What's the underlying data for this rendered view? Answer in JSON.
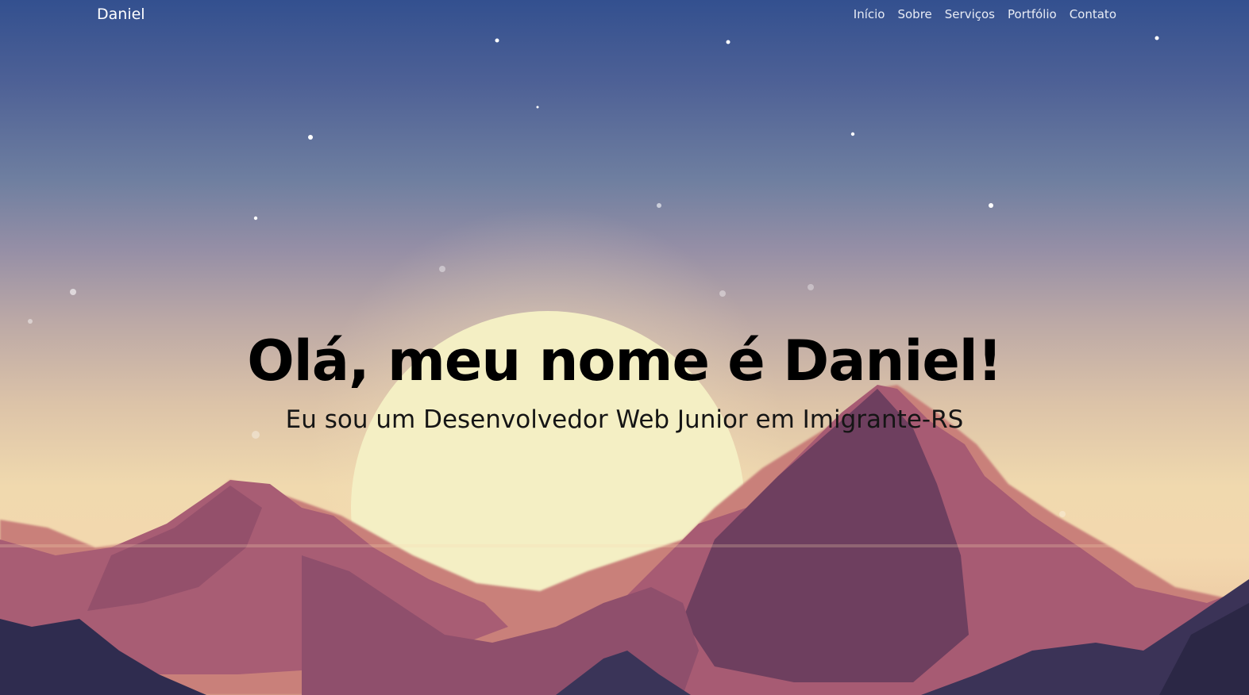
{
  "navbar": {
    "brand": "Daniel",
    "links": [
      {
        "label": "Início"
      },
      {
        "label": "Sobre"
      },
      {
        "label": "Serviços"
      },
      {
        "label": "Portfólio"
      },
      {
        "label": "Contato"
      }
    ]
  },
  "hero": {
    "title": "Olá, meu nome é Daniel!",
    "subtitle": "Eu sou um Desenvolvedor Web Junior em Imigrante-RS",
    "background": "night-sky-sunset-mountains-illustration"
  },
  "colors": {
    "sky_top": "#33508f",
    "sky_mid": "#968fa6",
    "horizon": "#f0d9ae",
    "sun": "#f5f0c2",
    "mountain_light": "#c97a6e",
    "mountain_mid": "#a55a72",
    "mountain_dark": "#6a3e5e",
    "foreground": "#2c2a4a"
  }
}
